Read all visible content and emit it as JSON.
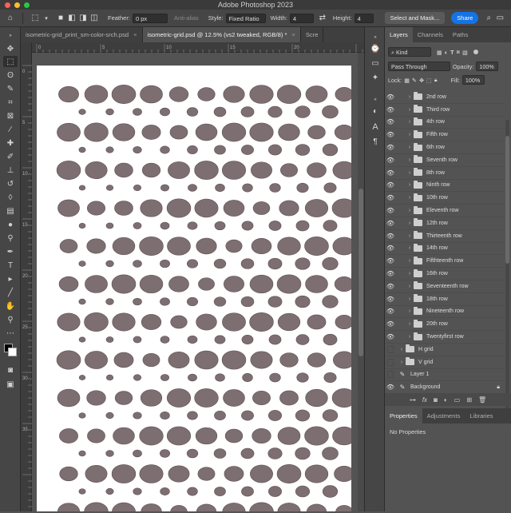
{
  "app": {
    "title": "Adobe Photoshop 2023"
  },
  "options": {
    "feather_label": "Feather:",
    "feather_value": "0 px",
    "antialias_label": "Anti-alias",
    "style_label": "Style:",
    "style_value": "Fixed Ratio",
    "width_label": "Width:",
    "width_value": "4",
    "height_label": "Height:",
    "height_value": "4",
    "select_mask_label": "Select and Mask...",
    "share_label": "Share"
  },
  "doc_tabs": [
    {
      "label": "isometric-grid_print_sm-color-srch.psd",
      "active": false
    },
    {
      "label": "isometric-grid.psd @ 12.5% (vs2 tweaked, RGB/8) *",
      "active": true
    },
    {
      "label": "Scre",
      "active": false
    }
  ],
  "panel_tabs": [
    "Layers",
    "Channels",
    "Paths"
  ],
  "layers_panel": {
    "kind_label": "Kind",
    "blend_mode": "Pass Through",
    "opacity_label": "Opacity:",
    "opacity_value": "100%",
    "lock_label": "Lock:",
    "fill_label": "Fill:",
    "fill_value": "100%"
  },
  "layers": [
    {
      "name": "2nd row",
      "type": "group",
      "visible": true,
      "indent": 1
    },
    {
      "name": "Third row",
      "type": "group",
      "visible": true,
      "indent": 1
    },
    {
      "name": "4th row",
      "type": "group",
      "visible": true,
      "indent": 1
    },
    {
      "name": "Fifth row",
      "type": "group",
      "visible": true,
      "indent": 1
    },
    {
      "name": "6th row",
      "type": "group",
      "visible": true,
      "indent": 1
    },
    {
      "name": "Seventh row",
      "type": "group",
      "visible": true,
      "indent": 1
    },
    {
      "name": "8th row",
      "type": "group",
      "visible": true,
      "indent": 1
    },
    {
      "name": "Ninth row",
      "type": "group",
      "visible": true,
      "indent": 1
    },
    {
      "name": "10th row",
      "type": "group",
      "visible": true,
      "indent": 1
    },
    {
      "name": "Eleventh row",
      "type": "group",
      "visible": true,
      "indent": 1
    },
    {
      "name": "12th row",
      "type": "group",
      "visible": true,
      "indent": 1
    },
    {
      "name": "Thirteenth row",
      "type": "group",
      "visible": true,
      "indent": 1
    },
    {
      "name": "14th row",
      "type": "group",
      "visible": true,
      "indent": 1
    },
    {
      "name": "Fifthteenth row",
      "type": "group",
      "visible": true,
      "indent": 1
    },
    {
      "name": "16th row",
      "type": "group",
      "visible": true,
      "indent": 1
    },
    {
      "name": "Seventeenth row",
      "type": "group",
      "visible": true,
      "indent": 1
    },
    {
      "name": "18th row",
      "type": "group",
      "visible": true,
      "indent": 1
    },
    {
      "name": "Nineteenth row",
      "type": "group",
      "visible": true,
      "indent": 1
    },
    {
      "name": "20th row",
      "type": "group",
      "visible": true,
      "indent": 1
    },
    {
      "name": "Twentyfirst row",
      "type": "group",
      "visible": true,
      "indent": 1
    },
    {
      "name": "H grid",
      "type": "group",
      "visible": false,
      "indent": 0
    },
    {
      "name": "V grid",
      "type": "group",
      "visible": false,
      "indent": 0
    },
    {
      "name": "Layer 1",
      "type": "brush",
      "visible": false,
      "indent": 0
    },
    {
      "name": "Background",
      "type": "brush",
      "visible": true,
      "indent": 0,
      "locked": true
    }
  ],
  "properties_tabs": [
    "Properties",
    "Adjustments",
    "Libraries"
  ],
  "properties_text": "No Properties",
  "ruler_h_ticks": [
    "0",
    "5",
    "10",
    "15",
    "20"
  ],
  "ruler_v_ticks": [
    "0",
    "5",
    "10",
    "15",
    "20",
    "25",
    "30",
    "35"
  ],
  "colors": {
    "dot_fill": "#7d6f71",
    "dot_stroke": "#5c5052",
    "accent": "#1473e6"
  }
}
